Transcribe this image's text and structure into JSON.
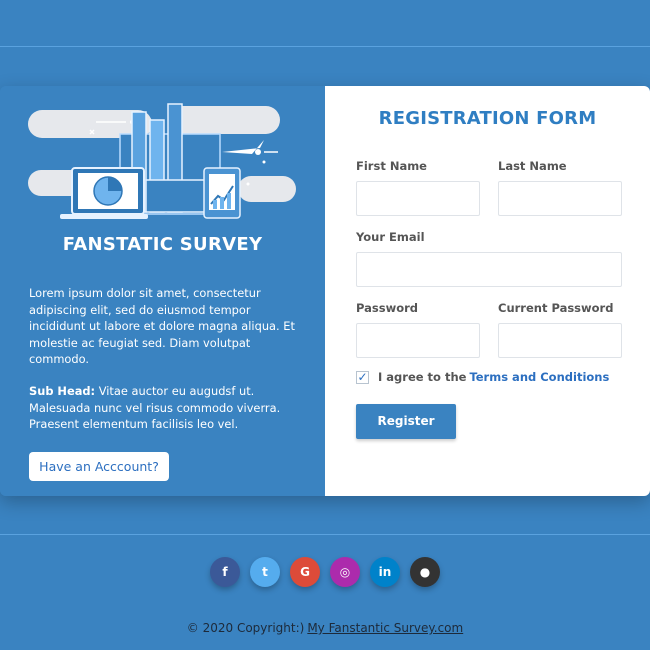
{
  "survey": {
    "title": "FANSTATIC SURVEY",
    "description": "Lorem ipsum dolor sit amet, consectetur adipiscing elit, sed do eiusmod tempor incididunt ut labore et dolore magna aliqua. Et molestie ac feugiat sed. Diam volutpat commodo.",
    "subhead_label": "Sub Head:",
    "subhead_text": " Vitae auctor eu augudsf ut. Malesuada nunc vel risus commodo viverra. Praesent elementum facilisis leo vel.",
    "account_button": "Have an Acccount?"
  },
  "form": {
    "title": "REGISTRATION FORM",
    "first_name_label": "First Name",
    "last_name_label": "Last Name",
    "email_label": "Your Email",
    "password_label": "Password",
    "current_password_label": "Current Password",
    "first_name_value": "",
    "last_name_value": "",
    "email_value": "",
    "password_value": "",
    "current_password_value": "",
    "agree_text": "I agree to the",
    "terms_link": "Terms and Conditions",
    "agree_checked": true,
    "register_button": "Register"
  },
  "social": [
    {
      "name": "facebook-icon",
      "glyph": "f",
      "color": "#3b5998"
    },
    {
      "name": "twitter-icon",
      "glyph": "t",
      "color": "#55acee"
    },
    {
      "name": "google-icon",
      "glyph": "G",
      "color": "#dd4b39"
    },
    {
      "name": "instagram-icon",
      "glyph": "◎",
      "color": "#ac2bac"
    },
    {
      "name": "linkedin-icon",
      "glyph": "in",
      "color": "#0082ca"
    },
    {
      "name": "github-icon",
      "glyph": "●",
      "color": "#333333"
    }
  ],
  "footer": {
    "copyright": "© 2020 Copyright:)",
    "site_link": "My Fanstantic Survey.com"
  },
  "colors": {
    "background": "#3a83c1",
    "accent": "#2f7ec2"
  }
}
